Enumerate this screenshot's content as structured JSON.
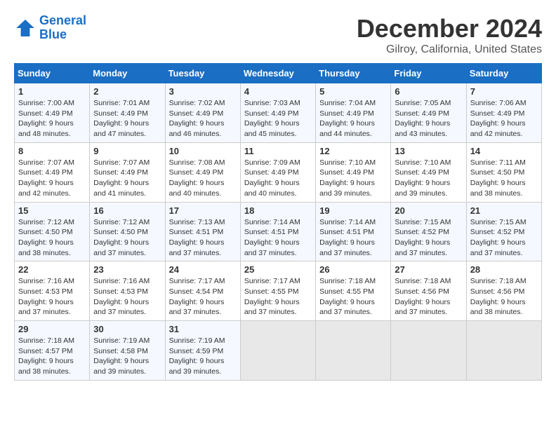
{
  "logo": {
    "name_part1": "General",
    "name_part2": "Blue"
  },
  "header": {
    "title": "December 2024",
    "subtitle": "Gilroy, California, United States"
  },
  "weekdays": [
    "Sunday",
    "Monday",
    "Tuesday",
    "Wednesday",
    "Thursday",
    "Friday",
    "Saturday"
  ],
  "weeks": [
    [
      {
        "day": 1,
        "sunrise": "7:00 AM",
        "sunset": "4:49 PM",
        "daylight": "9 hours and 48 minutes."
      },
      {
        "day": 2,
        "sunrise": "7:01 AM",
        "sunset": "4:49 PM",
        "daylight": "9 hours and 47 minutes."
      },
      {
        "day": 3,
        "sunrise": "7:02 AM",
        "sunset": "4:49 PM",
        "daylight": "9 hours and 46 minutes."
      },
      {
        "day": 4,
        "sunrise": "7:03 AM",
        "sunset": "4:49 PM",
        "daylight": "9 hours and 45 minutes."
      },
      {
        "day": 5,
        "sunrise": "7:04 AM",
        "sunset": "4:49 PM",
        "daylight": "9 hours and 44 minutes."
      },
      {
        "day": 6,
        "sunrise": "7:05 AM",
        "sunset": "4:49 PM",
        "daylight": "9 hours and 43 minutes."
      },
      {
        "day": 7,
        "sunrise": "7:06 AM",
        "sunset": "4:49 PM",
        "daylight": "9 hours and 42 minutes."
      }
    ],
    [
      {
        "day": 8,
        "sunrise": "7:07 AM",
        "sunset": "4:49 PM",
        "daylight": "9 hours and 42 minutes."
      },
      {
        "day": 9,
        "sunrise": "7:07 AM",
        "sunset": "4:49 PM",
        "daylight": "9 hours and 41 minutes."
      },
      {
        "day": 10,
        "sunrise": "7:08 AM",
        "sunset": "4:49 PM",
        "daylight": "9 hours and 40 minutes."
      },
      {
        "day": 11,
        "sunrise": "7:09 AM",
        "sunset": "4:49 PM",
        "daylight": "9 hours and 40 minutes."
      },
      {
        "day": 12,
        "sunrise": "7:10 AM",
        "sunset": "4:49 PM",
        "daylight": "9 hours and 39 minutes."
      },
      {
        "day": 13,
        "sunrise": "7:10 AM",
        "sunset": "4:49 PM",
        "daylight": "9 hours and 39 minutes."
      },
      {
        "day": 14,
        "sunrise": "7:11 AM",
        "sunset": "4:50 PM",
        "daylight": "9 hours and 38 minutes."
      }
    ],
    [
      {
        "day": 15,
        "sunrise": "7:12 AM",
        "sunset": "4:50 PM",
        "daylight": "9 hours and 38 minutes."
      },
      {
        "day": 16,
        "sunrise": "7:12 AM",
        "sunset": "4:50 PM",
        "daylight": "9 hours and 37 minutes."
      },
      {
        "day": 17,
        "sunrise": "7:13 AM",
        "sunset": "4:51 PM",
        "daylight": "9 hours and 37 minutes."
      },
      {
        "day": 18,
        "sunrise": "7:14 AM",
        "sunset": "4:51 PM",
        "daylight": "9 hours and 37 minutes."
      },
      {
        "day": 19,
        "sunrise": "7:14 AM",
        "sunset": "4:51 PM",
        "daylight": "9 hours and 37 minutes."
      },
      {
        "day": 20,
        "sunrise": "7:15 AM",
        "sunset": "4:52 PM",
        "daylight": "9 hours and 37 minutes."
      },
      {
        "day": 21,
        "sunrise": "7:15 AM",
        "sunset": "4:52 PM",
        "daylight": "9 hours and 37 minutes."
      }
    ],
    [
      {
        "day": 22,
        "sunrise": "7:16 AM",
        "sunset": "4:53 PM",
        "daylight": "9 hours and 37 minutes."
      },
      {
        "day": 23,
        "sunrise": "7:16 AM",
        "sunset": "4:53 PM",
        "daylight": "9 hours and 37 minutes."
      },
      {
        "day": 24,
        "sunrise": "7:17 AM",
        "sunset": "4:54 PM",
        "daylight": "9 hours and 37 minutes."
      },
      {
        "day": 25,
        "sunrise": "7:17 AM",
        "sunset": "4:55 PM",
        "daylight": "9 hours and 37 minutes."
      },
      {
        "day": 26,
        "sunrise": "7:18 AM",
        "sunset": "4:55 PM",
        "daylight": "9 hours and 37 minutes."
      },
      {
        "day": 27,
        "sunrise": "7:18 AM",
        "sunset": "4:56 PM",
        "daylight": "9 hours and 37 minutes."
      },
      {
        "day": 28,
        "sunrise": "7:18 AM",
        "sunset": "4:56 PM",
        "daylight": "9 hours and 38 minutes."
      }
    ],
    [
      {
        "day": 29,
        "sunrise": "7:18 AM",
        "sunset": "4:57 PM",
        "daylight": "9 hours and 38 minutes."
      },
      {
        "day": 30,
        "sunrise": "7:19 AM",
        "sunset": "4:58 PM",
        "daylight": "9 hours and 39 minutes."
      },
      {
        "day": 31,
        "sunrise": "7:19 AM",
        "sunset": "4:59 PM",
        "daylight": "9 hours and 39 minutes."
      },
      null,
      null,
      null,
      null
    ]
  ]
}
